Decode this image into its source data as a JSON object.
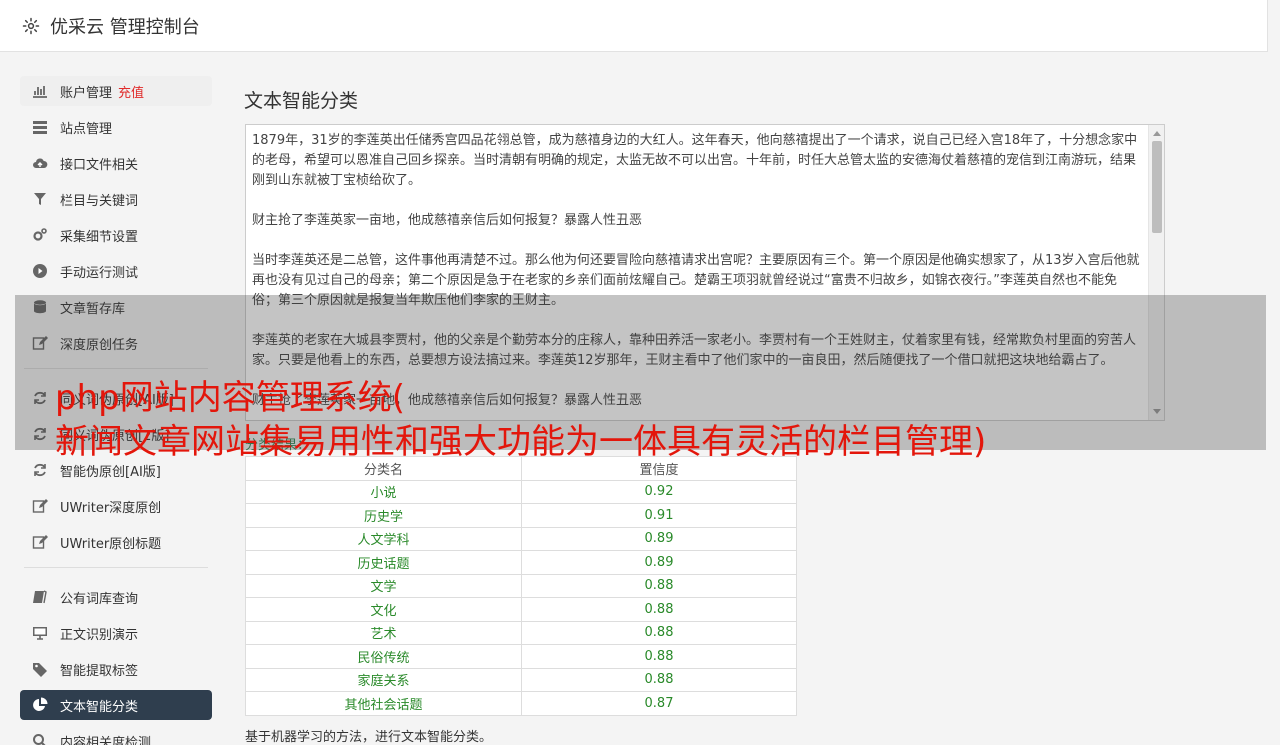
{
  "header": {
    "title": "优采云 管理控制台"
  },
  "sidebar": {
    "group1": [
      {
        "label": "账户管理",
        "badge": "充值",
        "icon": "bar-chart-icon"
      },
      {
        "label": "站点管理",
        "icon": "server-icon"
      },
      {
        "label": "接口文件相关",
        "icon": "cloud-upload-icon"
      },
      {
        "label": "栏目与关键词",
        "icon": "filter-icon"
      },
      {
        "label": "采集细节设置",
        "icon": "gears-icon"
      },
      {
        "label": "手动运行测试",
        "icon": "play-icon"
      },
      {
        "label": "文章暂存库",
        "icon": "database-icon"
      },
      {
        "label": "深度原创任务",
        "icon": "edit-icon"
      }
    ],
    "group2": [
      {
        "label": "同义词伪原创[AI版]",
        "icon": "refresh-icon"
      },
      {
        "label": "同义词伪原创[2版]",
        "icon": "refresh-icon"
      },
      {
        "label": "智能伪原创[AI版]",
        "icon": "refresh-icon"
      },
      {
        "label": "UWriter深度原创",
        "icon": "edit-icon"
      },
      {
        "label": "UWriter原创标题",
        "icon": "edit-icon"
      }
    ],
    "group3": [
      {
        "label": "公有词库查询",
        "icon": "book-icon"
      },
      {
        "label": "正文识别演示",
        "icon": "monitor-icon"
      },
      {
        "label": "智能提取标签",
        "icon": "tag-icon"
      },
      {
        "label": "文本智能分类",
        "icon": "pie-chart-icon"
      },
      {
        "label": "内容相关度检测",
        "icon": "search-icon"
      }
    ]
  },
  "main": {
    "title": "文本智能分类",
    "text_content": "1879年，31岁的李莲英出任储秀宫四品花翎总管，成为慈禧身边的大红人。这年春天，他向慈禧提出了一个请求，说自己已经入宫18年了，十分想念家中的老母，希望可以恩准自己回乡探亲。当时清朝有明确的规定，太监无故不可以出宫。十年前，时任大总管太监的安德海仗着慈禧的宠信到江南游玩，结果刚到山东就被丁宝桢给砍了。\n\n财主抢了李莲英家一亩地，他成慈禧亲信后如何报复？暴露人性丑恶\n\n当时李莲英还是二总管，这件事他再清楚不过。那么他为何还要冒险向慈禧请求出宫呢？主要原因有三个。第一个原因是他确实想家了，从13岁入宫后他就再也没有见过自己的母亲；第二个原因是急于在老家的乡亲们面前炫耀自己。楚霸王项羽就曾经说过“富贵不归故乡，如锦衣夜行。”李莲英自然也不能免俗；第三个原因就是报复当年欺压他们李家的王财主。\n\n李莲英的老家在大城县李贾村，他的父亲是个勤劳本分的庄稼人，靠种田养活一家老小。李贾村有一个王姓财主，仗着家里有钱，经常欺负村里面的穷苦人家。只要是他看上的东西，总要想方设法搞过来。李莲英12岁那年，王财主看中了他们家中的一亩良田，然后随便找了一个借口就把这块地给霸占了。\n\n财主抢了李莲英家一亩地，他成慈禧亲信后如何报复？暴露人性丑恶",
    "result_label": "分类结果：",
    "table": {
      "headers": [
        "分类名",
        "置信度"
      ],
      "rows": [
        [
          "小说",
          "0.92"
        ],
        [
          "历史学",
          "0.91"
        ],
        [
          "人文学科",
          "0.89"
        ],
        [
          "历史话题",
          "0.89"
        ],
        [
          "文学",
          "0.88"
        ],
        [
          "文化",
          "0.88"
        ],
        [
          "艺术",
          "0.88"
        ],
        [
          "民俗传统",
          "0.88"
        ],
        [
          "家庭关系",
          "0.88"
        ],
        [
          "其他社会话题",
          "0.87"
        ]
      ]
    },
    "footer_note": "基于机器学习的方法，进行文本智能分类。"
  },
  "overlay": {
    "line1": "php网站内容管理系统(",
    "line2": "新闻文章网站集易用性和强大功能为一体具有灵活的栏目管理)"
  },
  "colors": {
    "active_bg": "#2f3e4e",
    "recharge": "#e02b2b",
    "result_green": "#2a8a2a",
    "overlay_text": "#e3160b"
  }
}
